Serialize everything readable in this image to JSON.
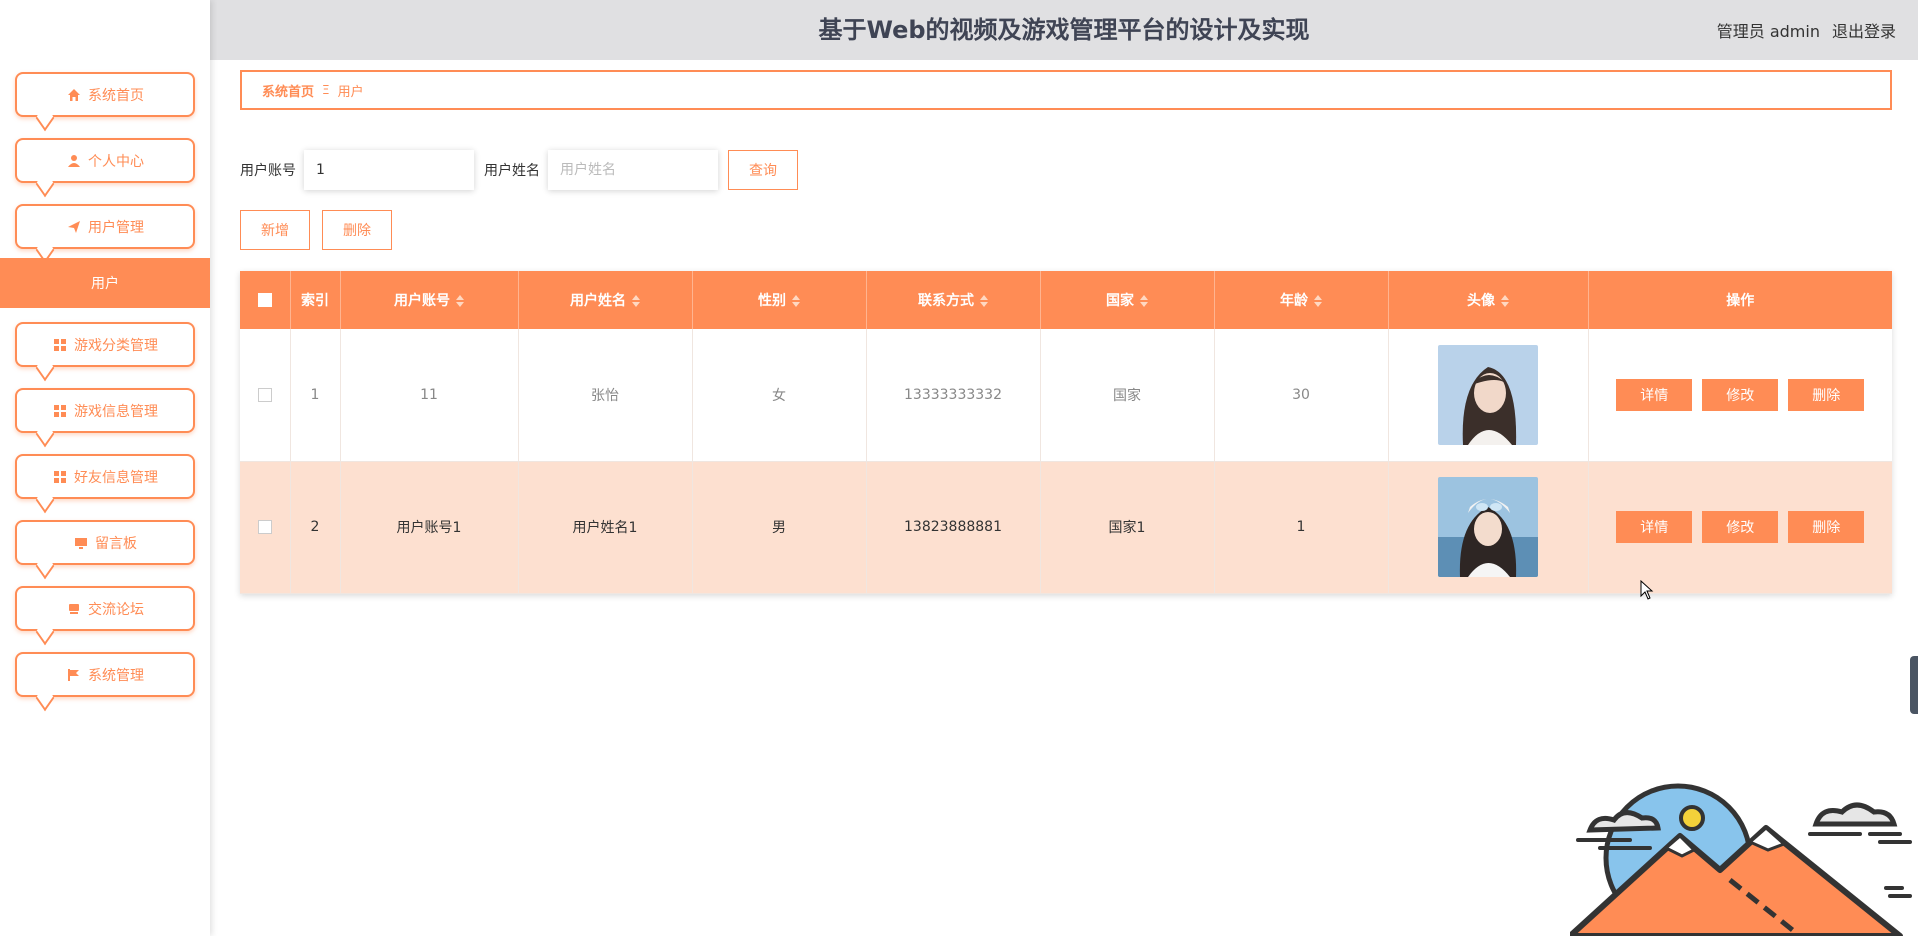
{
  "header": {
    "title": "基于Web的视频及游戏管理平台的设计及实现",
    "user": "管理员 admin",
    "logout": "退出登录"
  },
  "sidebar": {
    "items": [
      {
        "label": "系统首页",
        "icon": "home-icon"
      },
      {
        "label": "个人中心",
        "icon": "person-icon"
      },
      {
        "label": "用户管理",
        "icon": "send-icon"
      },
      {
        "label": "游戏分类管理",
        "icon": "grid-icon"
      },
      {
        "label": "游戏信息管理",
        "icon": "grid-icon"
      },
      {
        "label": "好友信息管理",
        "icon": "grid-icon"
      },
      {
        "label": "留言板",
        "icon": "monitor-icon"
      },
      {
        "label": "交流论坛",
        "icon": "chat-icon"
      },
      {
        "label": "系统管理",
        "icon": "flag-icon"
      }
    ],
    "active_sub": "用户"
  },
  "breadcrumb": {
    "home": "系统首页",
    "separator": "Ξ",
    "current": "用户"
  },
  "search": {
    "account_label": "用户账号",
    "account_value": "1",
    "name_label": "用户姓名",
    "name_placeholder": "用户姓名",
    "query_button": "查询"
  },
  "actions": {
    "add": "新增",
    "delete": "删除"
  },
  "table": {
    "columns": [
      "索引",
      "用户账号",
      "用户姓名",
      "性别",
      "联系方式",
      "国家",
      "年龄",
      "头像",
      "操作"
    ],
    "rows": [
      {
        "index": "1",
        "account": "11",
        "name": "张怡",
        "gender": "女",
        "phone": "13333333332",
        "country": "国家",
        "age": "30"
      },
      {
        "index": "2",
        "account": "用户账号1",
        "name": "用户姓名1",
        "gender": "男",
        "phone": "13823888881",
        "country": "国家1",
        "age": "1"
      }
    ],
    "ops": {
      "detail": "详情",
      "edit": "修改",
      "delete": "删除"
    }
  },
  "colors": {
    "accent": "#ff8c55",
    "row_highlight": "#fde0d0",
    "header_bg": "#e0e0e2"
  }
}
